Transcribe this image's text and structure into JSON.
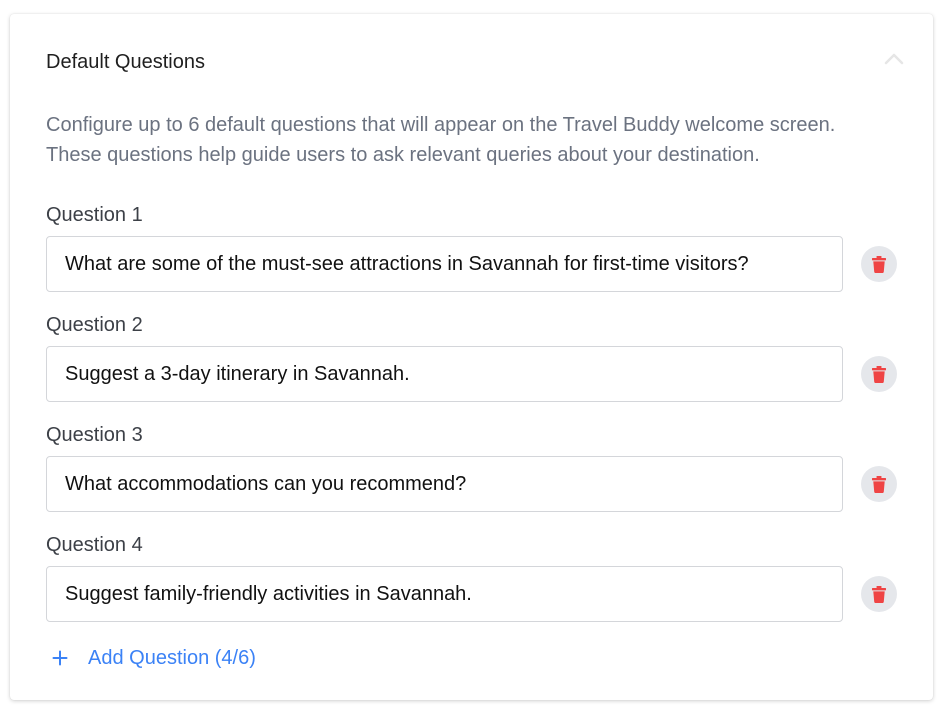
{
  "section": {
    "title": "Default Questions",
    "collapse_icon": "chevron-up-icon",
    "description": "Configure up to 6 default questions that will appear on the Travel Buddy welcome screen. These questions help guide users to ask relevant queries about your destination."
  },
  "questions": [
    {
      "label": "Question 1",
      "value": "What are some of the must-see attractions in Savannah for first-time visitors?"
    },
    {
      "label": "Question 2",
      "value": "Suggest a 3-day itinerary in Savannah."
    },
    {
      "label": "Question 3",
      "value": "What accommodations can you recommend?"
    },
    {
      "label": "Question 4",
      "value": "Suggest family-friendly activities in Savannah."
    }
  ],
  "delete_icon": "trash-icon",
  "add_button": {
    "icon": "plus-icon",
    "label": "Add Question (4/6)"
  },
  "colors": {
    "accent": "#3b82f6",
    "delete": "#ef4444",
    "delete_bg": "#e5e7eb",
    "description_text": "#6b7280"
  }
}
